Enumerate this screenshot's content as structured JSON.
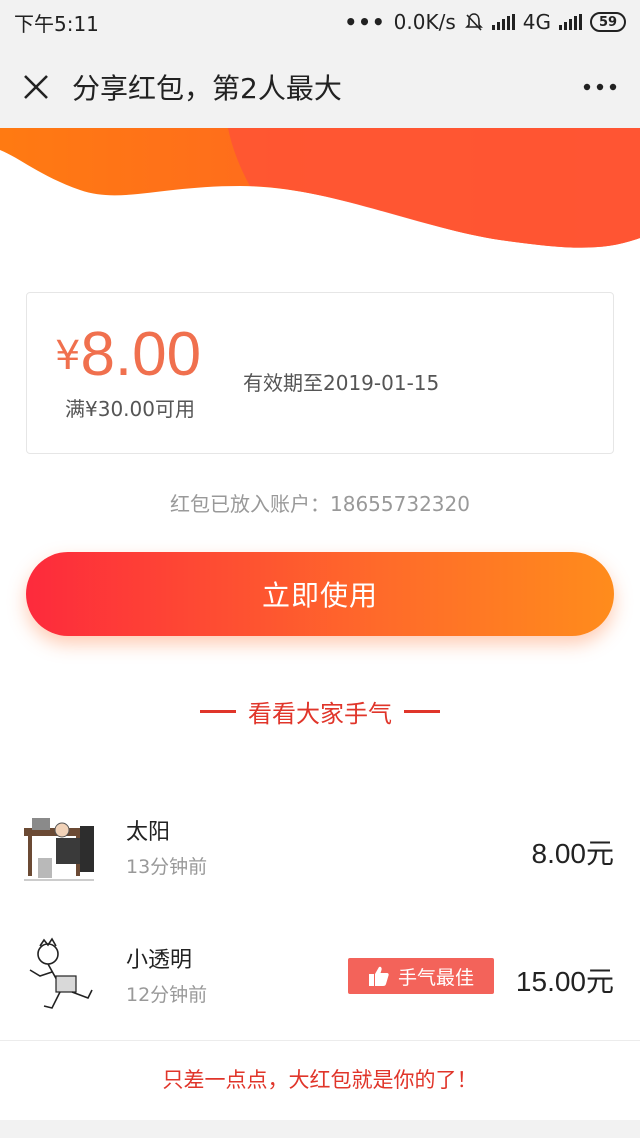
{
  "status_bar": {
    "time": "下午5:11",
    "net_speed": "0.0K/s",
    "network_type": "4G",
    "battery": "59"
  },
  "title_bar": {
    "title": "分享红包，第2人最大"
  },
  "coupon": {
    "currency": "¥",
    "amount": "8.00",
    "condition": "满¥30.00可用",
    "expiry": "有效期至2019-01-15"
  },
  "account_text": "红包已放入账户：18655732320",
  "use_button_label": "立即使用",
  "section_title": "看看大家手气",
  "records": [
    {
      "name": "太阳",
      "time": "13分钟前",
      "amount": "8.00元"
    },
    {
      "name": "小透明",
      "time": "12分钟前",
      "amount": "15.00元",
      "badge": "手气最佳"
    }
  ],
  "footer_tip": "只差一点点，大红包就是你的了！",
  "colors": {
    "accent_red": "#e0352a",
    "amount_orange": "#f0704e",
    "button_start": "#fd2a3c",
    "button_end": "#ff8c1c",
    "badge_bg": "#f3635a"
  },
  "icons": [
    "close-icon",
    "more-icon",
    "thumbs-up-icon",
    "signal-icon",
    "mute-bell-icon",
    "battery-icon"
  ]
}
